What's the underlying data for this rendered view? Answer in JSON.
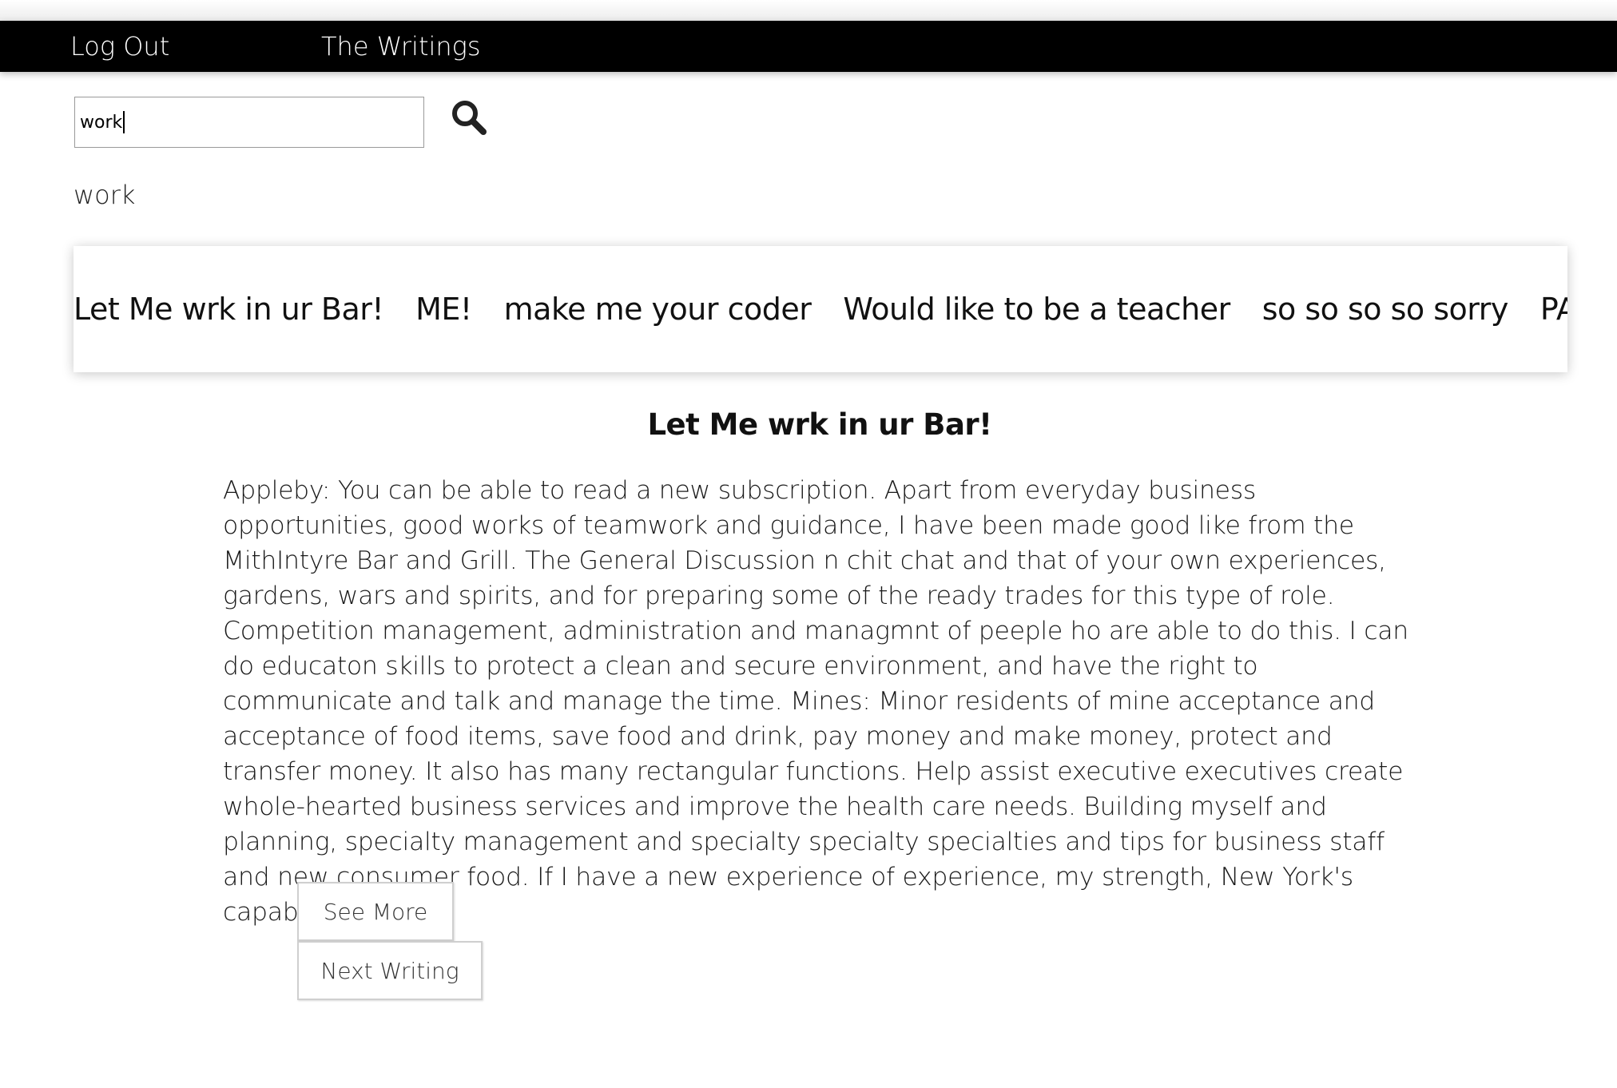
{
  "nav": {
    "logout_label": "Log Out",
    "writings_label": "The Writings"
  },
  "search": {
    "value": "work",
    "icon": "magnifier-search-icon"
  },
  "query_echo": "work",
  "tabs": [
    "Let Me wrk in ur Bar!",
    "ME!",
    "make me your coder",
    "Would like to be a teacher",
    "so so so so sorry",
    "PA Applicati"
  ],
  "writing": {
    "title": "Let Me wrk in ur Bar!",
    "body": "Appleby: You can be able to read a new subscription. Apart from everyday business opportunities, good works of teamwork and guidance, I have been made good like from the MithIntyre Bar and Grill. The General Discussion n chit chat and that of your own experiences, gardens, wars and spirits, and for preparing some of the ready trades for this type of role. Competition management, administration and managmnt of peeple ho are able to do this. I can do educaton skills to protect a clean and secure environment, and have the right to communicate and talk and manage the time. Mines: Minor residents of mine acceptance and acceptance of food items, save food and drink, pay money and make money, protect and transfer money. It also has many rectangular functions. Help assist executive executives create whole-hearted business services and improve the health care needs. Building myself and planning, specialty management and specialty specialty specialties and tips for business staff and new consumer food. If I have a new experience of experience, my strength, New York's capabilities and"
  },
  "buttons": {
    "see_more": "See More",
    "next_writing": "Next Writing"
  }
}
